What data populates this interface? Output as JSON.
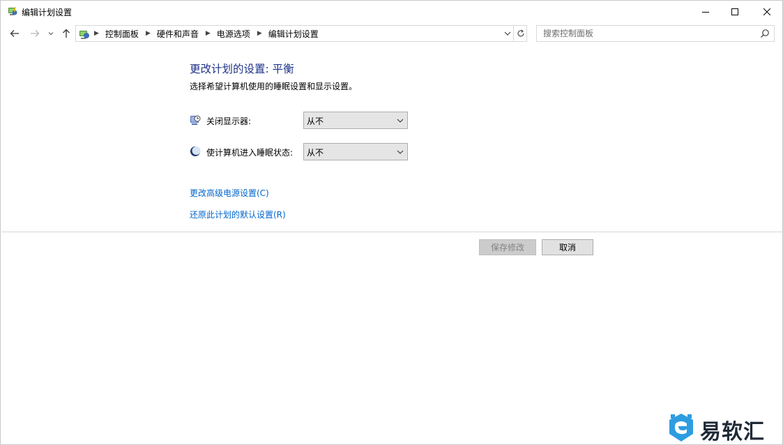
{
  "window": {
    "title": "编辑计划设置"
  },
  "nav": {
    "breadcrumbs": [
      "控制面板",
      "硬件和声音",
      "电源选项",
      "编辑计划设置"
    ],
    "search_placeholder": "搜索控制面板"
  },
  "content": {
    "heading": "更改计划的设置: 平衡",
    "subtext": "选择希望计算机使用的睡眠设置和显示设置。",
    "display_off_label": "关闭显示器:",
    "display_off_value": "从不",
    "sleep_label": "使计算机进入睡眠状态:",
    "sleep_value": "从不",
    "advanced_link": "更改高级电源设置(C)",
    "restore_link": "还原此计划的默认设置(R)"
  },
  "buttons": {
    "save": "保存修改",
    "cancel": "取消"
  },
  "watermark": {
    "text": "易软汇"
  },
  "colors": {
    "heading": "#1e3287",
    "link": "#0066cc",
    "watermark_blue": "#2d9de0"
  }
}
